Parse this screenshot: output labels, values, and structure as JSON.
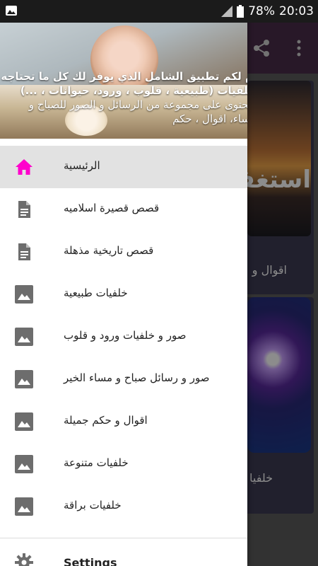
{
  "status_bar": {
    "battery": "78%",
    "time": "20:03"
  },
  "background_app": {
    "cards": [
      {
        "image_text": "استغفر",
        "label": "اقوال و"
      },
      {
        "label": "خلفيا"
      }
    ]
  },
  "drawer": {
    "header_lines": [
      "م لكم تطبيق الشامل الذي يوفر لك كل ما تحتاجه",
      "خلفيات (طبيعية ، قلوب ، ورود، حيوانات ، ...)",
      "يحتوى على مجموعة من الرسائل و الصور للصباح و",
      "ساء، اقوال ، حكم"
    ],
    "items": [
      {
        "label": "الرئيسية",
        "icon": "home-icon",
        "active": true
      },
      {
        "label": "قصص قصيرة اسلاميه",
        "icon": "document-icon"
      },
      {
        "label": "قصص تاريخية مذهلة",
        "icon": "document-icon"
      },
      {
        "label": "خلفيات طبيعية",
        "icon": "image-icon"
      },
      {
        "label": "صور و خلفيات ورود و قلوب",
        "icon": "image-icon"
      },
      {
        "label": "صور و رسائل صباح و مساء الخير",
        "icon": "image-icon"
      },
      {
        "label": "اقوال و حكم جميلة",
        "icon": "image-icon"
      },
      {
        "label": "خلفيات متنوعة",
        "icon": "image-icon"
      },
      {
        "label": "خلفيات براقة",
        "icon": "image-icon"
      }
    ],
    "settings_label": "Settings",
    "colors": {
      "active_icon": "#ff00cc",
      "icon": "#6d6d6d"
    }
  }
}
